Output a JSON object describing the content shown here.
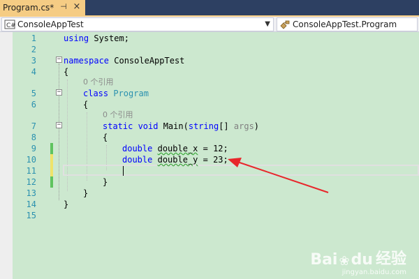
{
  "tab": {
    "title": "Program.cs*",
    "pin_glyph": "⊣",
    "close_glyph": "×"
  },
  "nav": {
    "left_combo": "ConsoleAppTest",
    "right_combo": "ConsoleAppTest.Program"
  },
  "lines": [
    {
      "n": "1"
    },
    {
      "n": "2"
    },
    {
      "n": "3"
    },
    {
      "n": "4"
    },
    {
      "n": "5"
    },
    {
      "n": "6"
    },
    {
      "n": "7"
    },
    {
      "n": "8"
    },
    {
      "n": "9"
    },
    {
      "n": "10"
    },
    {
      "n": "11"
    },
    {
      "n": "12"
    },
    {
      "n": "13"
    },
    {
      "n": "14"
    },
    {
      "n": "15"
    }
  ],
  "code": {
    "l1_using": "using",
    "l1_rest": " System;",
    "l3_namespace": "namespace",
    "l3_rest": " ConsoleAppTest",
    "l4": "{",
    "ref1": "0 个引用",
    "l5_class": "class",
    "l5_name": " Program",
    "l6": "{",
    "ref2": "0 个引用",
    "l7_static": "static",
    "l7_void": " void",
    "l7_main": " Main(",
    "l7_string": "string",
    "l7_rest": "[] ",
    "l7_args": "args",
    "l7_close": ")",
    "l8": "{",
    "l9_type": "double",
    "l9_var": "double_x",
    "l9_rest": " = 12;",
    "l10_type": "double",
    "l10_var": "double_y",
    "l10_rest": " = 23;",
    "l12": "}",
    "l13": "}",
    "l14": "}"
  },
  "colors": {
    "editor_bg": "#cce8cf",
    "keyword": "#0000ff",
    "type": "#2b91af",
    "tab_active": "#f5cc84",
    "arrow": "#e8262b"
  },
  "watermark": {
    "brand": "Bai",
    "paw": "du",
    "site": "经验",
    "url": "jingyan.baidu.com"
  }
}
